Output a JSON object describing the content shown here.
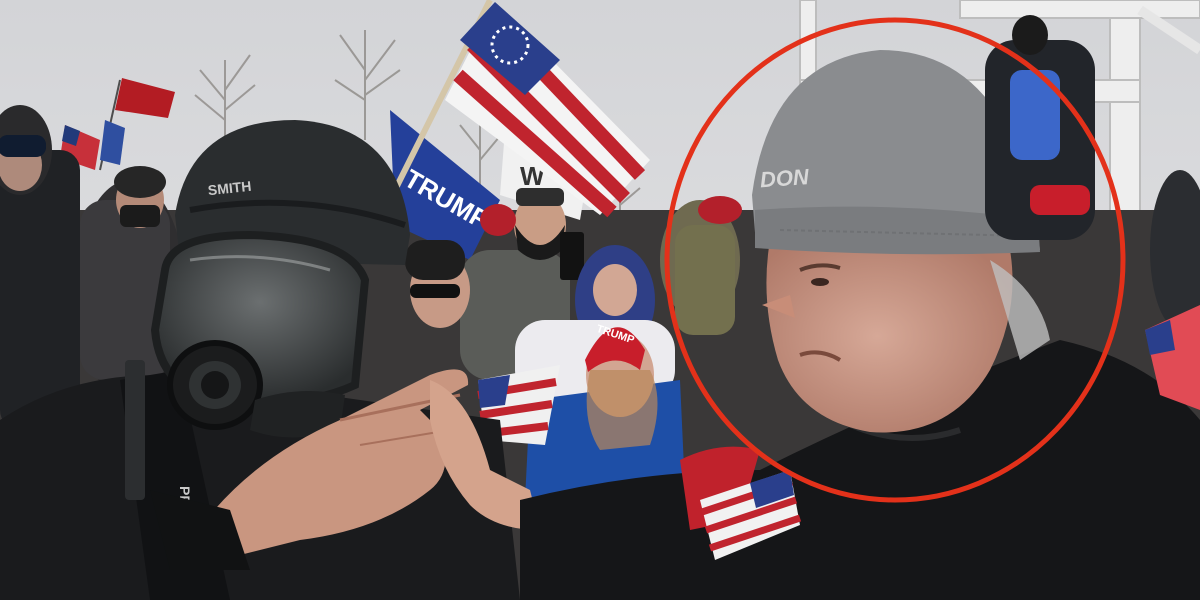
{
  "photo": {
    "helmet_text": "SMITH",
    "flag_text": "TRUMP",
    "banner_text": "W",
    "beanie_text": "DON",
    "hat_text": "TRUMP",
    "vest_text": "PRES"
  },
  "colors": {
    "sky": "#dcdde0",
    "highlight_circle": "#e3311a",
    "flag_red": "#c0242e",
    "flag_blue": "#2a3f8c",
    "beanie_gray": "#8a8c8f"
  }
}
